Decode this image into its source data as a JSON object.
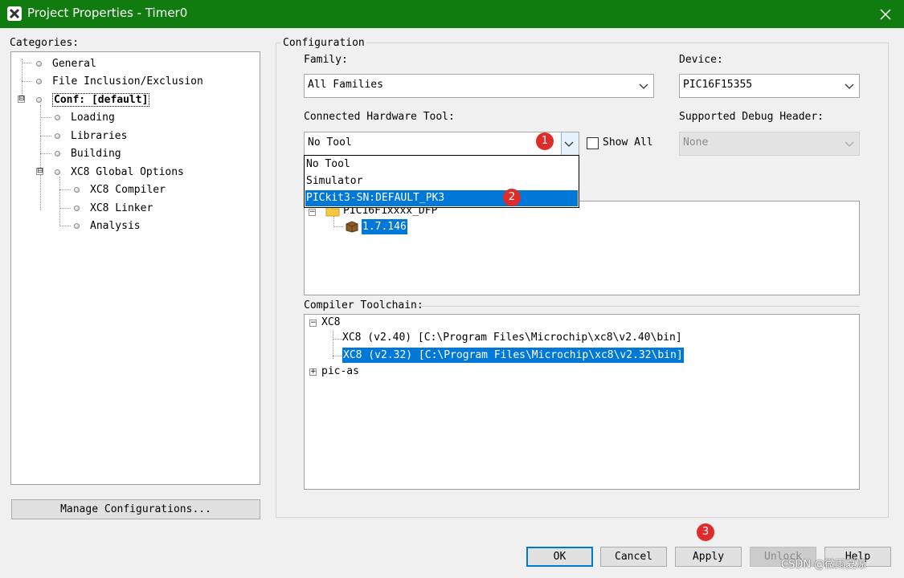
{
  "window": {
    "title": "Project Properties - Timer0",
    "close_icon": "×"
  },
  "categories": {
    "label": "Categories:",
    "items": {
      "general": "General",
      "file_inclusion": "File Inclusion/Exclusion",
      "conf": "Conf: [default]",
      "loading": "Loading",
      "libraries": "Libraries",
      "building": "Building",
      "xc8_global": "XC8 Global Options",
      "xc8_compiler": "XC8 Compiler",
      "xc8_linker": "XC8 Linker",
      "analysis": "Analysis"
    },
    "expander_conf": "⊟",
    "expander_xc8": "⊟"
  },
  "manage_button": "Manage Configurations...",
  "configuration": {
    "group_label": "Configuration",
    "family_label": "Family:",
    "family_value": "All Families",
    "device_label": "Device:",
    "device_value": "PIC16F15355",
    "hardware_label": "Connected Hardware Tool:",
    "hardware_value": "No Tool",
    "show_all_label": "Show All",
    "debug_header_label": "Supported Debug Header:",
    "debug_header_value": "None",
    "dropdown_options": [
      "No Tool",
      "Simulator",
      "PICkit3-SN:DEFAULT_PK3"
    ],
    "packs": {
      "pack_name": "PIC16F1xxxx_DFP",
      "pack_version": "1.7.146"
    },
    "compiler_toolchain_label": "Compiler Toolchain:",
    "toolchain": {
      "xc8_root": "XC8",
      "xc8_v240": "XC8 (v2.40) [C:\\Program Files\\Microchip\\xc8\\v2.40\\bin]",
      "xc8_v232": "XC8 (v2.32) [C:\\Program Files\\Microchip\\xc8\\v2.32\\bin]",
      "pic_as": "pic-as"
    }
  },
  "badges": [
    "1",
    "2",
    "3"
  ],
  "buttons": {
    "ok": "OK",
    "cancel": "Cancel",
    "apply": "Apply",
    "unlock": "Unlock",
    "help": "Help"
  },
  "watermark": "CSDN @微雨夏凉",
  "colors": {
    "titlebar": "#107c10",
    "selection": "#0078d7",
    "badge": "#e02b2b"
  }
}
